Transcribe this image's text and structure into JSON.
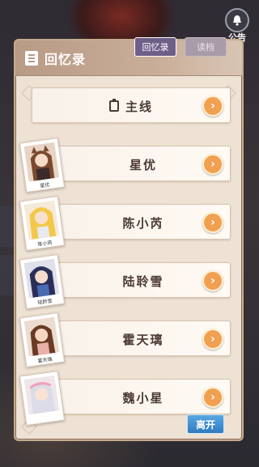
{
  "notice": {
    "label": "公告",
    "icon": "bell-icon"
  },
  "panel": {
    "title": "回忆录",
    "tabs": [
      {
        "label": "回忆录",
        "active": true
      },
      {
        "label": "读档",
        "active": false
      }
    ]
  },
  "rows": [
    {
      "name": "主线",
      "caption": ""
    },
    {
      "name": "星优",
      "caption": "星优"
    },
    {
      "name": "陈小芮",
      "caption": "陈小芮"
    },
    {
      "name": "陆聆雪",
      "caption": "陆聆雪"
    },
    {
      "name": "霍天璃",
      "caption": "霍天璃"
    },
    {
      "name": "魏小星",
      "caption": ""
    }
  ],
  "leave_button": "离开",
  "colors": {
    "accent": "#f0a050",
    "panel": "#eee2d5",
    "tab_active": "#6d5f88",
    "leave": "#2f7ac0"
  }
}
